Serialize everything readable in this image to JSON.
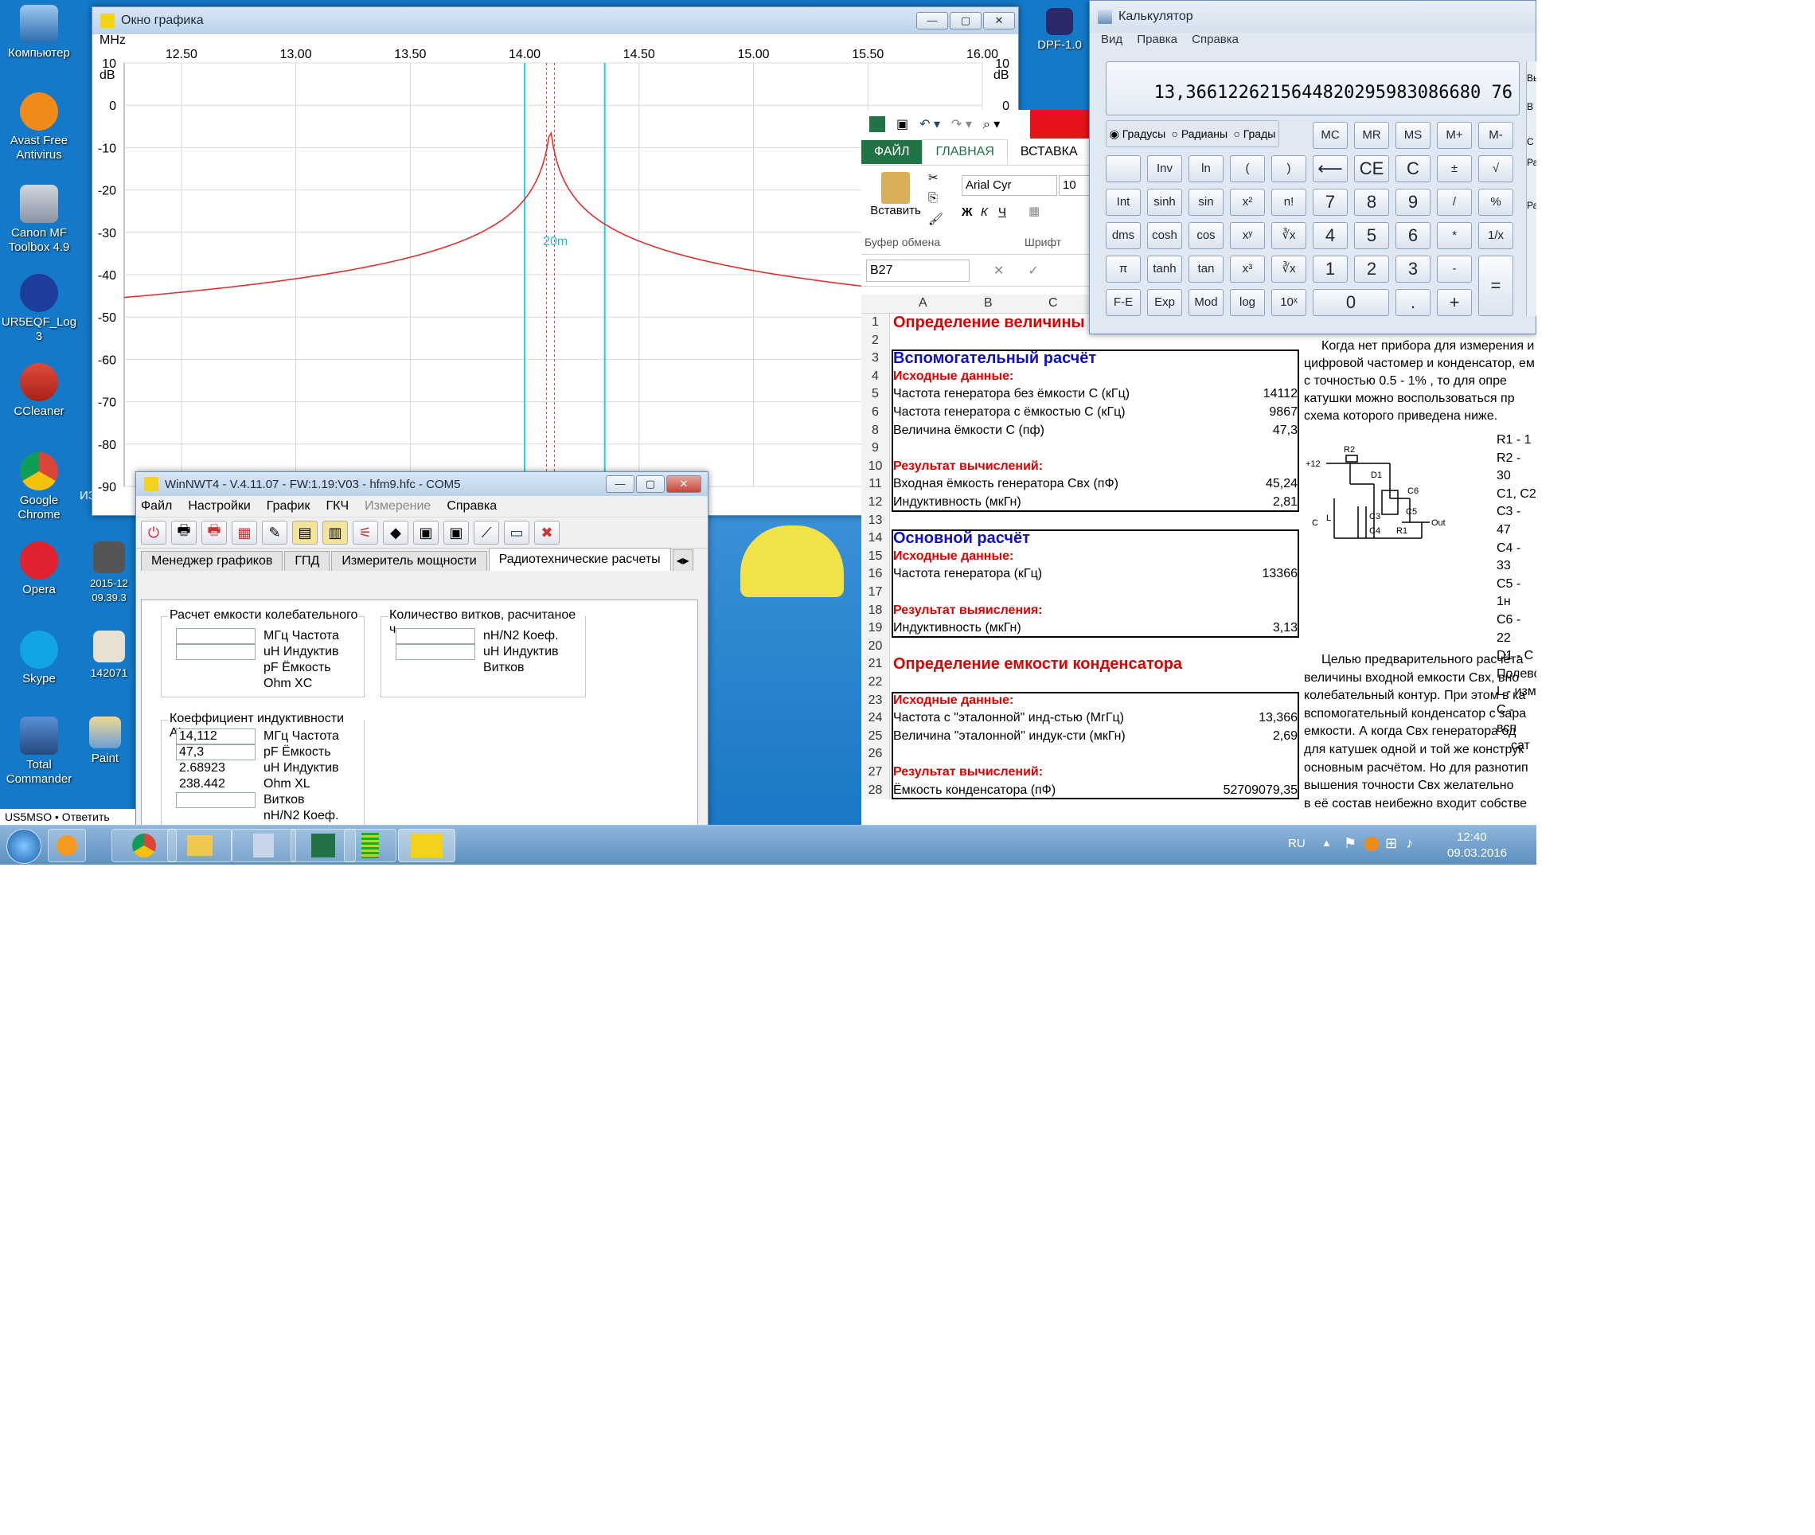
{
  "desktop": {
    "icons": [
      {
        "label": "Компьютер"
      },
      {
        "label": "Avast Free Antivirus"
      },
      {
        "label": "Canon MF Toolbox 4.9"
      },
      {
        "label": "UR5EQF_Log 3"
      },
      {
        "label": "CCleaner"
      },
      {
        "label": "Google Chrome"
      },
      {
        "label": "Opera"
      },
      {
        "label": "Skype"
      },
      {
        "label": "Total Commander"
      },
      {
        "label": "Paint"
      },
      {
        "label": "2015-12 09.39.3"
      },
      {
        "label": "142071"
      },
      {
        "label": "DPF-1.0"
      },
      {
        "label": "ИЗМЕР"
      }
    ]
  },
  "graph": {
    "title": "Окно графика",
    "unit_x": "MHz",
    "unit_y": "dB",
    "marker_label": "20m",
    "x_ticks": [
      "12.50",
      "13.00",
      "13.50",
      "14.00",
      "14.50",
      "15.00",
      "15.50",
      "16.00"
    ],
    "y_ticks": [
      "10",
      "0",
      "-10",
      "-20",
      "-30",
      "-40",
      "-50",
      "-60",
      "-70",
      "-80",
      "-90"
    ],
    "right_ticks": [
      "10",
      "0"
    ]
  },
  "nwt": {
    "title": "WinNWT4 - V.4.11.07 - FW:1.19:V03 - hfm9.hfc - COM5",
    "menu": [
      "Файл",
      "Настройки",
      "График",
      "ГКЧ",
      "Измерение",
      "Справка"
    ],
    "tabs": [
      "Менеджер графиков",
      "ГПД",
      "Измеритель мощности",
      "Радиотехнические расчеты"
    ],
    "group1": {
      "title": "Расчет емкости колебательного",
      "rows": [
        "МГц Частота",
        "uH Индуктив",
        "pF Ёмкость",
        "Ohm XC"
      ]
    },
    "group2": {
      "title": "Количество витков, расчитаное ч",
      "rows": [
        "nH/N2 Коеф.",
        "uH Индуктив",
        "Витков"
      ]
    },
    "group3": {
      "title": "Коеффициент индуктивности AL",
      "rows": [
        {
          "value": "14,112",
          "label": "МГц Частота"
        },
        {
          "value": "47,3",
          "label": "pF Ёмкость"
        },
        {
          "value": "2.68923",
          "label": "uH Индуктив"
        },
        {
          "value": "238.442",
          "label": "Ohm XL"
        },
        {
          "value": "",
          "label": "Витков"
        },
        {
          "value": "",
          "label": "nH/N2 Коеф."
        }
      ]
    },
    "status": "US5MSO • Ответить"
  },
  "excel": {
    "tabs": [
      "ФАЙЛ",
      "ГЛАВНАЯ",
      "ВСТАВКА"
    ],
    "font_name": "Arial Cyr",
    "font_size": "10",
    "paste_label": "Вставить",
    "clipboard_label": "Буфер обмена",
    "font_label": "Шрифт",
    "name_box": "B27",
    "col_headers": [
      "A",
      "B",
      "C"
    ],
    "rows": [
      {
        "n": "1",
        "text": "Определение величины",
        "value": "",
        "cls": "hd-red"
      },
      {
        "n": "2",
        "text": "",
        "value": "",
        "cls": ""
      },
      {
        "n": "3",
        "text": "Вспомогательный расчёт",
        "value": "",
        "cls": "hd-blue"
      },
      {
        "n": "4",
        "text": "Исходные данные:",
        "value": "",
        "cls": "red-b"
      },
      {
        "n": "5",
        "text": "Частота генератора без ёмкости С (кГц)",
        "value": "14112",
        "cls": ""
      },
      {
        "n": "6",
        "text": "Частота генератора с ёмкостью  С (кГц)",
        "value": "9867",
        "cls": ""
      },
      {
        "n": "8",
        "text": "Величина ёмкости С (пф)",
        "value": "47,3",
        "cls": ""
      },
      {
        "n": "9",
        "text": "",
        "value": "",
        "cls": ""
      },
      {
        "n": "10",
        "text": "Результат вычислений:",
        "value": "",
        "cls": "red-b"
      },
      {
        "n": "11",
        "text": "Входная ёмкость генератора Свх (пФ)",
        "value": "45,24",
        "cls": ""
      },
      {
        "n": "12",
        "text": "Индуктивность (мкГн)",
        "value": "2,81",
        "cls": ""
      },
      {
        "n": "13",
        "text": "",
        "value": "",
        "cls": ""
      },
      {
        "n": "14",
        "text": "Основной расчёт",
        "value": "",
        "cls": "hd-blue"
      },
      {
        "n": "15",
        "text": "Исходные данные:",
        "value": "",
        "cls": "red-b"
      },
      {
        "n": "16",
        "text": "Частота генератора (кГц)",
        "value": "13366",
        "cls": ""
      },
      {
        "n": "17",
        "text": "",
        "value": "",
        "cls": ""
      },
      {
        "n": "18",
        "text": "Результат выяисления:",
        "value": "",
        "cls": "red-b"
      },
      {
        "n": "19",
        "text": "Индуктивность (мкГн)",
        "value": "3,13",
        "cls": ""
      },
      {
        "n": "20",
        "text": "",
        "value": "",
        "cls": ""
      },
      {
        "n": "21",
        "text": "Определение емкости конденсатора",
        "value": "",
        "cls": "hd-red"
      },
      {
        "n": "22",
        "text": "",
        "value": "",
        "cls": ""
      },
      {
        "n": "23",
        "text": "Исходные данные:",
        "value": "",
        "cls": "red-b"
      },
      {
        "n": "24",
        "text": "Частота с \"эталонной\" инд-стью (МгГц)",
        "value": "13,366",
        "cls": ""
      },
      {
        "n": "25",
        "text": "Величина \"эталонной\" индук-сти (мкГн)",
        "value": "2,69",
        "cls": ""
      },
      {
        "n": "26",
        "text": "",
        "value": "",
        "cls": ""
      },
      {
        "n": "27",
        "text": "Результат вычислений:",
        "value": "",
        "cls": "red-b"
      },
      {
        "n": "28",
        "text": "Ёмкость конденсатора (пФ)",
        "value": "52709079,35",
        "cls": ""
      }
    ],
    "side_text": [
      "Когда нет прибора для измерения и",
      "цифровой частомер и конденсатор, ем",
      "с  точностью   0.5 - 1% ,   то для опре",
      "катушки  можно  воспользоваться  пр",
      "схема которого приведена ниже."
    ],
    "parts": [
      "R1 - 1",
      "R2 - 30",
      "C1, C2",
      "C3 - 47",
      "C4 - 33",
      "C5 - 1н",
      "C6 - 22",
      "D1 - С",
      "Полево",
      "L - изм",
      "C - всп",
      "сат"
    ],
    "side_text2": [
      "Целью предварительного расчёта",
      "величины  входной  емкости  Свх,  вно",
      "колебательный контур. При этом в ка",
      "вспомогательный конденсатор с зара",
      "емкости.     А когда Свх генератора од",
      "для катушек одной и той же конструк",
      "основным расчётом. Но для разнотип",
      "вышения точности  Свх  желательно",
      "в её состав неибежно входит собстве"
    ],
    "schematic_labels": [
      "+12",
      "R2",
      "D1",
      "C6",
      "Out",
      "L",
      "C3",
      "C4",
      "R1",
      "C5",
      "C"
    ]
  },
  "calc": {
    "title": "Калькулятор",
    "menu": [
      "Вид",
      "Правка",
      "Справка"
    ],
    "display": "13,3661226215644820295983086680 76",
    "angle_modes": [
      "Градусы",
      "Радианы",
      "Грады"
    ],
    "mem": [
      "MC",
      "MR",
      "MS",
      "M+",
      "M-"
    ],
    "row1": [
      "",
      "Inv",
      "ln",
      "(",
      ")",
      "⟵",
      "CE",
      "C",
      "±",
      "√"
    ],
    "row2": [
      "Int",
      "sinh",
      "sin",
      "x²",
      "n!",
      "7",
      "8",
      "9",
      "/",
      "%"
    ],
    "row3": [
      "dms",
      "cosh",
      "cos",
      "xʸ",
      "∛x",
      "4",
      "5",
      "6",
      "*",
      "1/x"
    ],
    "row4": [
      "π",
      "tanh",
      "tan",
      "x³",
      "∛x",
      "1",
      "2",
      "3",
      "-",
      "="
    ],
    "row5": [
      "F-E",
      "Exp",
      "Mod",
      "log",
      "10ˣ",
      "0",
      ".",
      "+"
    ],
    "side": [
      "Вь",
      "В",
      "С",
      "Ра",
      "Ра"
    ]
  },
  "taskbar": {
    "lang": "RU",
    "time": "12:40",
    "date": "09.03.2016"
  }
}
